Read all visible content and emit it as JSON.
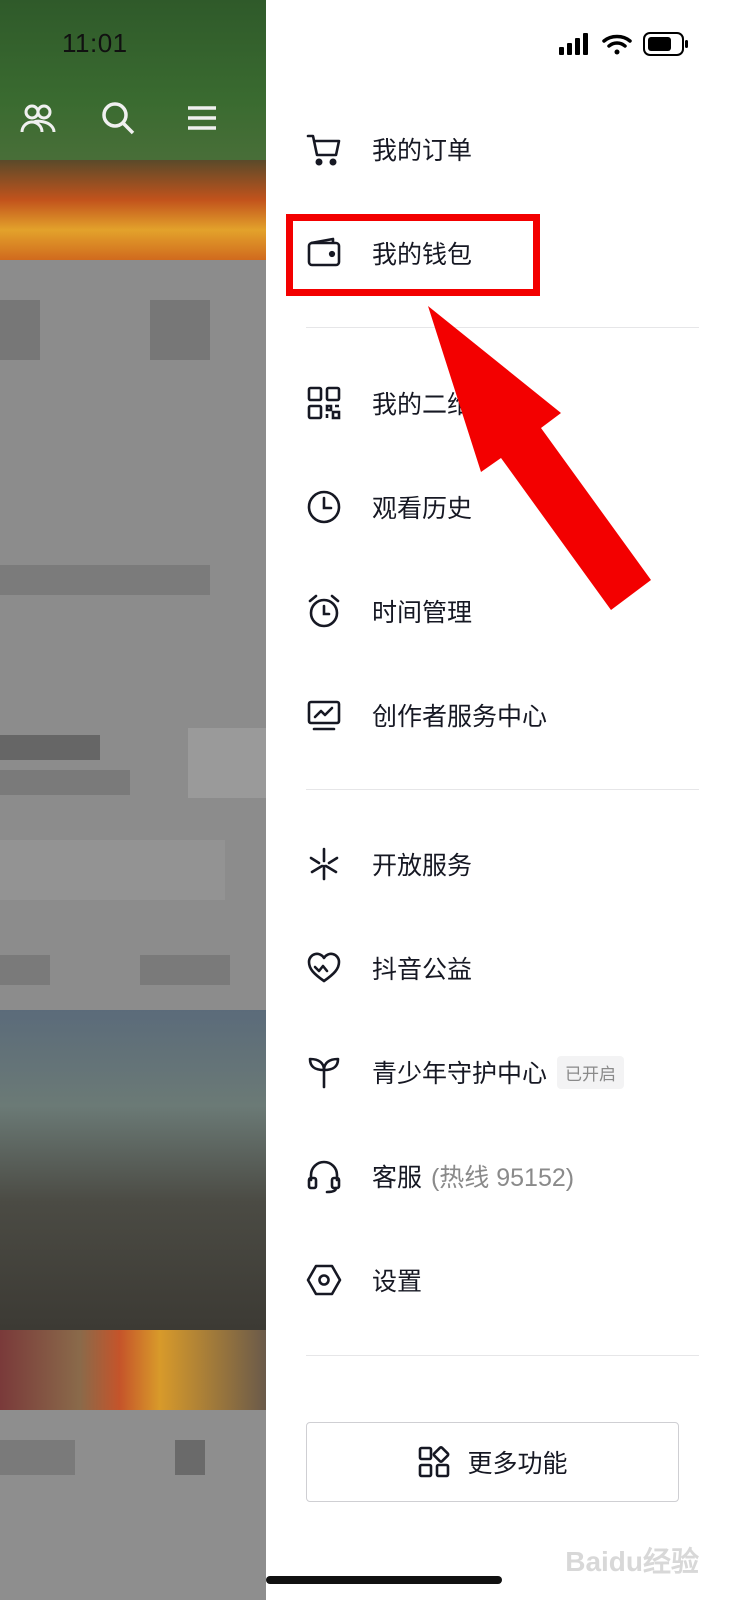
{
  "status_bar": {
    "time": "11:01"
  },
  "menu": {
    "orders": "我的订单",
    "wallet": "我的钱包",
    "qrcode": "我的二维码",
    "history": "观看历史",
    "time_mgmt": "时间管理",
    "creator_center": "创作者服务中心",
    "open_service": "开放服务",
    "charity": "抖音公益",
    "youth_center": "青少年守护中心",
    "youth_badge": "已开启",
    "customer_service": "客服",
    "hotline": "(热线 95152)",
    "settings": "设置",
    "more_functions": "更多功能"
  },
  "watermark": "Baidu经验",
  "colors": {
    "highlight": "#f30000",
    "text": "#161823",
    "muted": "#8a8a8a"
  },
  "icons": [
    "cart-icon",
    "wallet-icon",
    "qr-code-icon",
    "clock-icon",
    "alarm-icon",
    "monitor-chart-icon",
    "spark-icon",
    "heart-icon",
    "sprout-icon",
    "headset-icon",
    "hexagon-gear-icon",
    "grid-icon"
  ]
}
